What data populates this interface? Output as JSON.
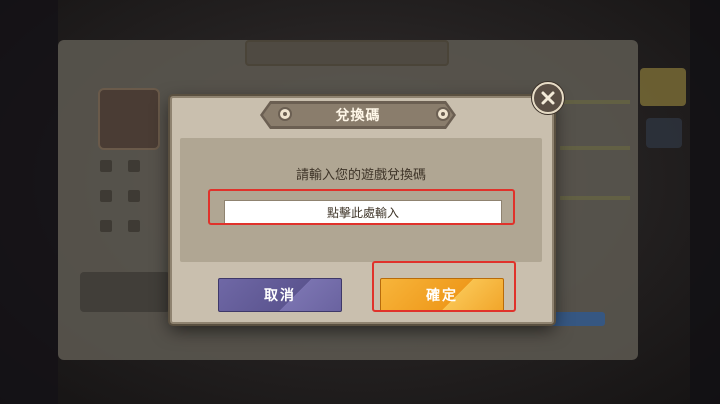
{
  "dialog": {
    "title": "兌換碼",
    "prompt": "請輸入您的遊戲兌換碼",
    "input_placeholder": "點擊此處輸入",
    "cancel_label": "取消",
    "confirm_label": "確定"
  },
  "colors": {
    "dialog_bg": "#c9bfae",
    "title_bar": "#8a7d6c",
    "cancel_button": "#6f68a6",
    "confirm_button": "#ef9a1c",
    "highlight": "#e0322b"
  },
  "icons": {
    "close": "close-icon"
  }
}
